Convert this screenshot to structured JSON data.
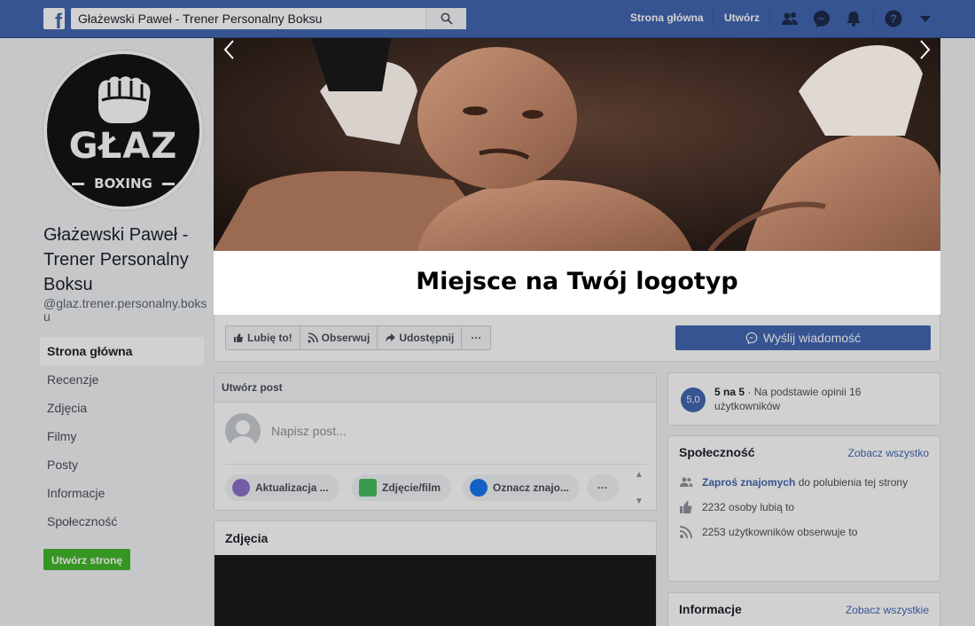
{
  "topbar": {
    "search_value": "Głażewski Paweł - Trener Personalny Boksu",
    "nav_home": "Strona główna",
    "nav_create": "Utwórz"
  },
  "profile": {
    "logo_word": "GŁAZ",
    "logo_sub": "BOXING",
    "name": "Głażewski Paweł - Trener Personalny Boksu",
    "handle": "@glaz.trener.personalny.boksu"
  },
  "left_nav": {
    "items": [
      {
        "label": "Strona główna"
      },
      {
        "label": "Recenzje"
      },
      {
        "label": "Zdjęcia"
      },
      {
        "label": "Filmy"
      },
      {
        "label": "Posty"
      },
      {
        "label": "Informacje"
      },
      {
        "label": "Społeczność"
      }
    ],
    "create_page": "Utwórz stronę"
  },
  "banner": {
    "logo_text": "Miejsce na Twój logotyp"
  },
  "actions": {
    "like": "Lubię to!",
    "follow": "Obserwuj",
    "share": "Udostępnij",
    "more": "···",
    "send_message": "Wyślij wiadomość"
  },
  "composer": {
    "title": "Utwórz post",
    "placeholder": "Napisz post...",
    "chips": [
      "Aktualizacja ...",
      "Zdjęcie/film",
      "Oznacz znajo...",
      "···"
    ]
  },
  "photos": {
    "title": "Zdjęcia"
  },
  "rating": {
    "badge": "5,0",
    "score": "5 na 5",
    "text": " · Na podstawie opinii 16 użytkowników"
  },
  "community": {
    "title": "Społeczność",
    "see_all": "Zobacz wszystko",
    "invite_link": "Zaproś znajomych",
    "invite_text": " do polubienia tej strony",
    "likes": "2232 osoby lubią to",
    "followers": "2253 użytkowników obserwuje to"
  },
  "info": {
    "title": "Informacje",
    "see_all": "Zobacz wszystkie"
  },
  "colors": {
    "brand_blue": "#4267b2",
    "green": "#42b72a"
  }
}
